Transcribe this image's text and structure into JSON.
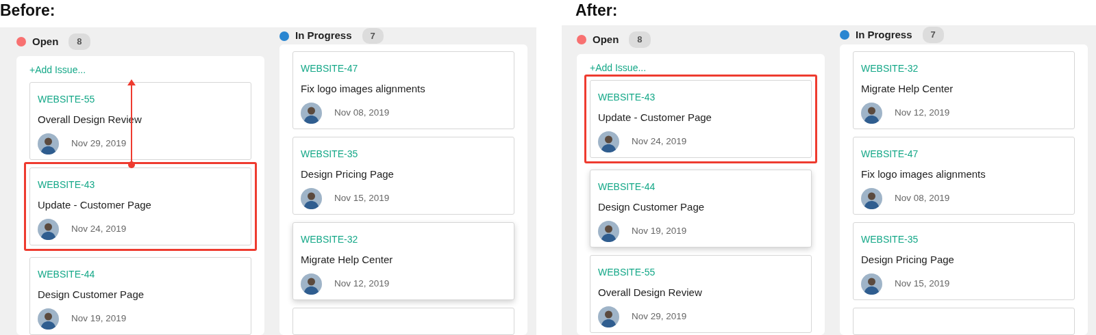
{
  "panels": [
    {
      "heading": "Before:",
      "arrow": true,
      "columns": [
        {
          "title": "Open",
          "count": "8",
          "color": "#f87171",
          "add_label": "+Add Issue...",
          "cards": [
            {
              "kind": "issue",
              "id": "WEBSITE-55",
              "title": "Overall Design Review",
              "date": "Nov 29, 2019",
              "highlighted": false,
              "raised": false
            },
            {
              "kind": "issue",
              "id": "WEBSITE-43",
              "title": "Update - Customer Page",
              "date": "Nov 24, 2019",
              "highlighted": true,
              "raised": false
            },
            {
              "kind": "issue",
              "id": "WEBSITE-44",
              "title": "Design Customer Page",
              "date": "Nov 19, 2019",
              "highlighted": false,
              "raised": false
            }
          ]
        },
        {
          "title": "In Progress",
          "count": "7",
          "color": "#2a86d1",
          "cards": [
            {
              "kind": "issue",
              "id": "WEBSITE-47",
              "title": "Fix logo images alignments",
              "date": "Nov 08, 2019",
              "highlighted": false,
              "raised": false
            },
            {
              "kind": "issue",
              "id": "WEBSITE-35",
              "title": "Design Pricing Page",
              "date": "Nov 15, 2019",
              "highlighted": false,
              "raised": false
            },
            {
              "kind": "issue",
              "id": "WEBSITE-32",
              "title": "Migrate Help Center",
              "date": "Nov 12, 2019",
              "highlighted": false,
              "raised": true
            },
            {
              "kind": "cut-off"
            }
          ]
        }
      ]
    },
    {
      "heading": "After:",
      "columns": [
        {
          "title": "Open",
          "count": "8",
          "color": "#f87171",
          "add_label": "+Add Issue...",
          "cards": [
            {
              "kind": "issue",
              "id": "WEBSITE-43",
              "title": "Update - Customer Page",
              "date": "Nov 24, 2019",
              "highlighted": true,
              "raised": false
            },
            {
              "kind": "issue",
              "id": "WEBSITE-44",
              "title": "Design Customer Page",
              "date": "Nov 19, 2019",
              "highlighted": false,
              "raised": true
            },
            {
              "kind": "issue",
              "id": "WEBSITE-55",
              "title": "Overall Design Review",
              "date": "Nov 29, 2019",
              "highlighted": false,
              "raised": false
            }
          ]
        },
        {
          "title": "In Progress",
          "count": "7",
          "color": "#2a86d1",
          "cards": [
            {
              "kind": "issue",
              "id": "WEBSITE-32",
              "title": "Migrate Help Center",
              "date": "Nov 12, 2019",
              "highlighted": false,
              "raised": false
            },
            {
              "kind": "issue",
              "id": "WEBSITE-47",
              "title": "Fix logo images alignments",
              "date": "Nov 08, 2019",
              "highlighted": false,
              "raised": false
            },
            {
              "kind": "issue",
              "id": "WEBSITE-35",
              "title": "Design Pricing Page",
              "date": "Nov 15, 2019",
              "highlighted": false,
              "raised": false
            },
            {
              "kind": "cut-off"
            }
          ]
        }
      ]
    }
  ]
}
